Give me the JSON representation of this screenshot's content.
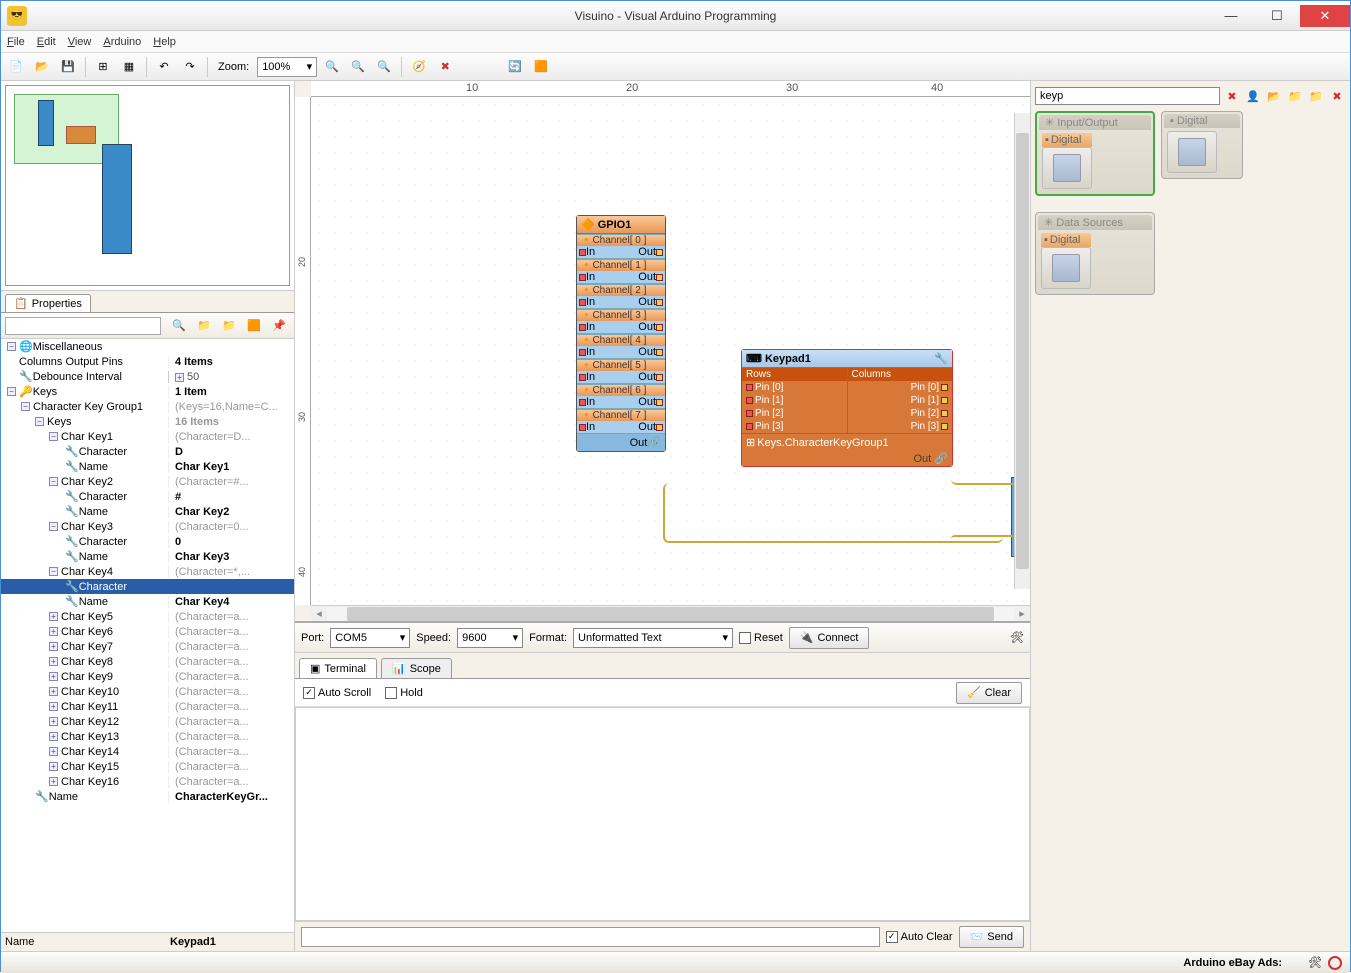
{
  "window": {
    "title": "Visuino - Visual Arduino Programming"
  },
  "menu": {
    "file": "File",
    "edit": "Edit",
    "view": "View",
    "arduino": "Arduino",
    "help": "Help"
  },
  "toolbar": {
    "zoom_label": "Zoom:",
    "zoom_value": "100%"
  },
  "properties": {
    "tab": "Properties",
    "misc": "Miscellaneous",
    "cols_pins": {
      "l": "Columns Output Pins",
      "v": "4 Items"
    },
    "debounce": {
      "l": "Debounce Interval",
      "v": "50"
    },
    "keys": {
      "l": "Keys",
      "v": "1 Item"
    },
    "ckg": {
      "l": "Character Key Group1",
      "v": "(Keys=16,Name=C..."
    },
    "keys16": {
      "l": "Keys",
      "v": "16 Items"
    },
    "ck1": {
      "l": "Char Key1",
      "v": "(Character=D..."
    },
    "ck1_char": {
      "l": "Character",
      "v": "D"
    },
    "ck1_name": {
      "l": "Name",
      "v": "Char Key1"
    },
    "ck2": {
      "l": "Char Key2",
      "v": "(Character=#..."
    },
    "ck2_char": {
      "l": "Character",
      "v": "#"
    },
    "ck2_name": {
      "l": "Name",
      "v": "Char Key2"
    },
    "ck3": {
      "l": "Char Key3",
      "v": "(Character=0..."
    },
    "ck3_char": {
      "l": "Character",
      "v": "0"
    },
    "ck3_name": {
      "l": "Name",
      "v": "Char Key3"
    },
    "ck4": {
      "l": "Char Key4",
      "v": "(Character=*,..."
    },
    "ck4_char": {
      "l": "Character",
      "v": ""
    },
    "ck4_name": {
      "l": "Name",
      "v": "Char Key4"
    },
    "ck5": {
      "l": "Char Key5",
      "v": "(Character=a..."
    },
    "ck6": {
      "l": "Char Key6",
      "v": "(Character=a..."
    },
    "ck7": {
      "l": "Char Key7",
      "v": "(Character=a..."
    },
    "ck8": {
      "l": "Char Key8",
      "v": "(Character=a..."
    },
    "ck9": {
      "l": "Char Key9",
      "v": "(Character=a..."
    },
    "ck10": {
      "l": "Char Key10",
      "v": "(Character=a..."
    },
    "ck11": {
      "l": "Char Key11",
      "v": "(Character=a..."
    },
    "ck12": {
      "l": "Char Key12",
      "v": "(Character=a..."
    },
    "ck13": {
      "l": "Char Key13",
      "v": "(Character=a..."
    },
    "ck14": {
      "l": "Char Key14",
      "v": "(Character=a..."
    },
    "ck15": {
      "l": "Char Key15",
      "v": "(Character=a..."
    },
    "ck16": {
      "l": "Char Key16",
      "v": "(Character=a..."
    },
    "name": {
      "l": "Name",
      "v": "CharacterKeyGr..."
    },
    "footer": {
      "l": "Name",
      "v": "Keypad1"
    }
  },
  "canvas": {
    "gpio_title": "GPIO1",
    "channels": [
      "Channel[ 0 ]",
      "Channel[ 1 ]",
      "Channel[ 2 ]",
      "Channel[ 3 ]",
      "Channel[ 4 ]",
      "Channel[ 5 ]",
      "Channel[ 6 ]",
      "Channel[ 7 ]"
    ],
    "in": "In",
    "out": "Out",
    "gpio_out": "Out",
    "keypad_title": "Keypad1",
    "rows": "Rows",
    "columns": "Columns",
    "row_pins": [
      "Pin [0]",
      "Pin [1]",
      "Pin [2]",
      "Pin [3]"
    ],
    "col_pins": [
      "Pin [0]",
      "Pin [1]",
      "Pin [2]",
      "Pin [3]"
    ],
    "keys_group": "Keys.CharacterKeyGroup1",
    "keys_out": "Out"
  },
  "ruler": {
    "r10": "10",
    "r20": "20",
    "r30": "30",
    "r40": "40",
    "v20": "20",
    "v30": "30",
    "v40": "40"
  },
  "serial": {
    "port_l": "Port:",
    "port": "COM5",
    "speed_l": "Speed:",
    "speed": "9600",
    "format_l": "Format:",
    "format": "Unformatted Text",
    "reset": "Reset",
    "connect": "Connect",
    "tab_terminal": "Terminal",
    "tab_scope": "Scope",
    "autoscroll": "Auto Scroll",
    "hold": "Hold",
    "clear": "Clear",
    "autoclear": "Auto Clear",
    "send": "Send"
  },
  "right": {
    "search": "keyp",
    "g_io": "Input/Output",
    "g_dig": "Digital",
    "g_ds": "Data Sources",
    "item_digital": "Digital"
  },
  "status": {
    "ads": "Arduino eBay Ads:"
  }
}
